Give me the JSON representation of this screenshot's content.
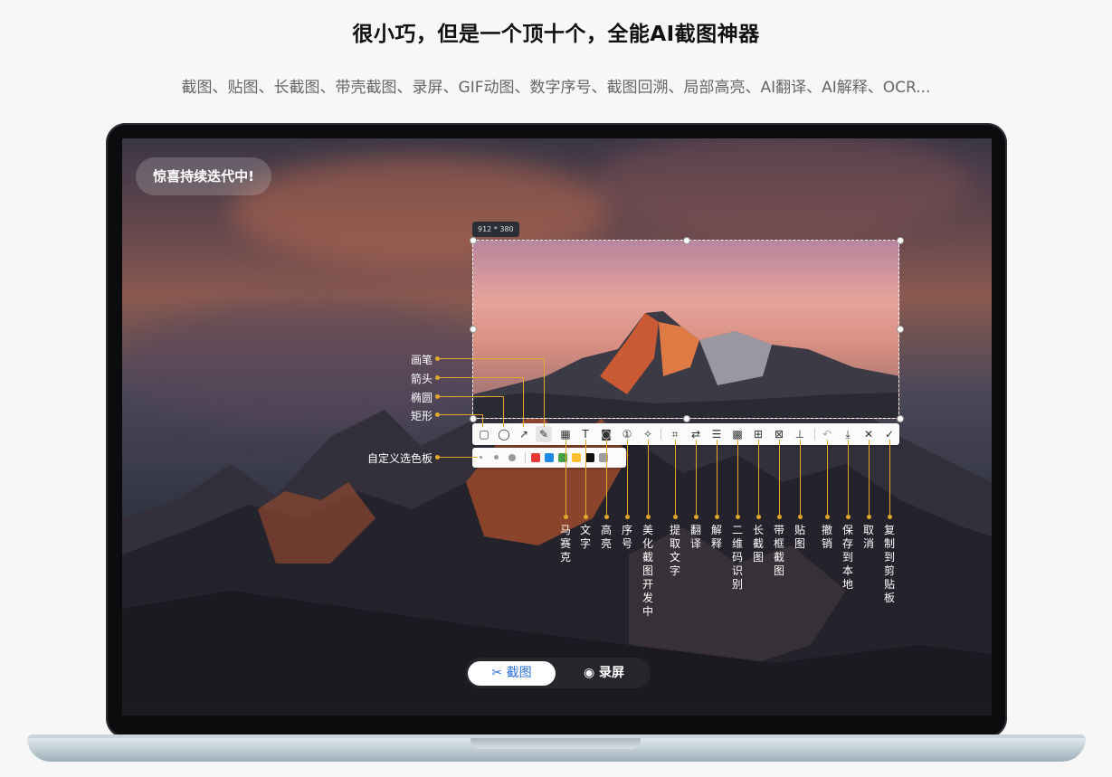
{
  "header": {
    "title": "很小巧，但是一个顶十个，全能AI截图神器",
    "subtitle": "截图、贴图、长截图、带壳截图、录屏、GIF动图、数字序号、截图回溯、局部高亮、AI翻译、AI解释、OCR..."
  },
  "screen": {
    "badge": "惊喜持续迭代中!",
    "selection_size": "912 * 380"
  },
  "annotations_left": {
    "brush": "画笔",
    "arrow": "箭头",
    "ellipse": "椭圆",
    "rect": "矩形",
    "palette": "自定义选色板"
  },
  "annotations_bottom": {
    "mosaic": "马赛克",
    "text": "文字",
    "highlight": "高亮",
    "number": "序号",
    "beautify": "美化截图开发中",
    "ocr": "提取文字",
    "translate": "翻译",
    "explain": "解释",
    "qrcode": "二维码识别",
    "long_shot": "长截图",
    "frame_shot": "带框截图",
    "pin": "贴图",
    "undo": "撤销",
    "save": "保存到本地",
    "cancel": "取消",
    "copy": "复制到剪贴板"
  },
  "mode_switch": {
    "screenshot": "截图",
    "record": "录屏"
  },
  "palette_colors": [
    "#e53935",
    "#1e88e5",
    "#43a047",
    "#fbc02d",
    "#111111",
    "#9e9e9e"
  ]
}
